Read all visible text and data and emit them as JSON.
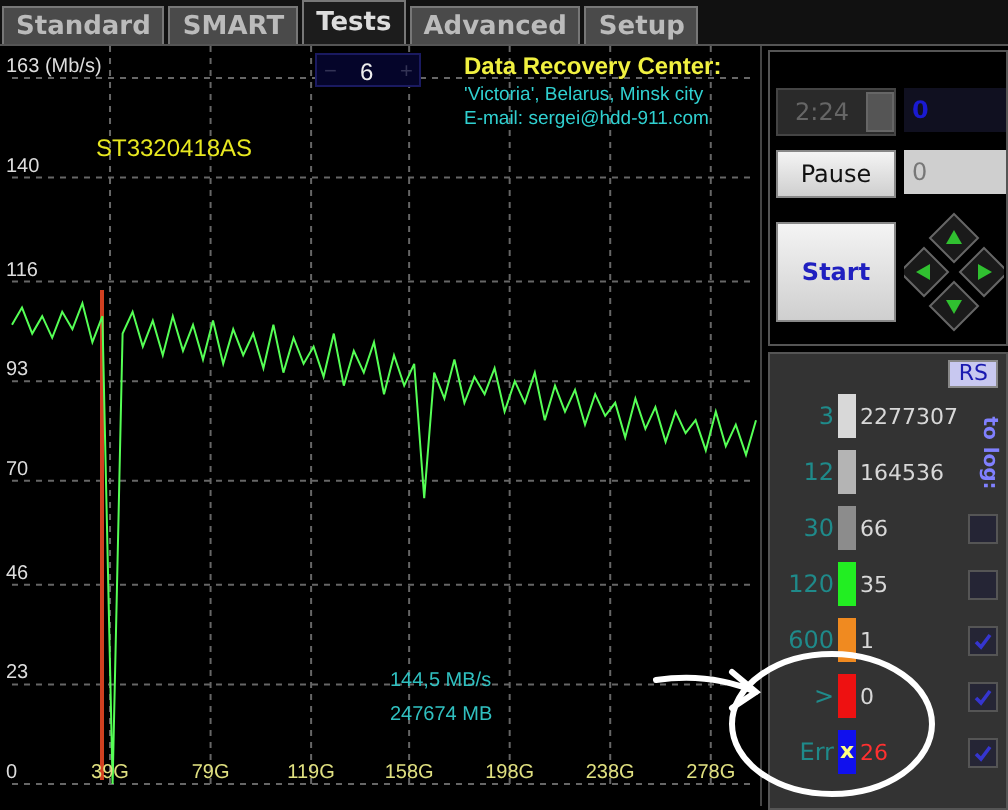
{
  "tabs": [
    {
      "label": "Standard",
      "selected": false
    },
    {
      "label": "SMART",
      "selected": false
    },
    {
      "label": "Tests",
      "selected": true
    },
    {
      "label": "Advanced",
      "selected": false
    },
    {
      "label": "Setup",
      "selected": false
    }
  ],
  "chart": {
    "drive_model": "ST3320418AS",
    "rate": "144,5 MB/s",
    "size": "247674 MB",
    "chart_data": {
      "type": "line",
      "xlim": [
        0,
        296
      ],
      "ylim": [
        0,
        163
      ],
      "grid": true,
      "yticks": [
        {
          "value": 163,
          "label": "163 (Mb/s)"
        },
        140,
        116,
        93,
        70,
        46,
        23,
        0
      ],
      "xticks": [
        {
          "value": 39,
          "label": "39G"
        },
        {
          "value": 79,
          "label": "79G"
        },
        {
          "value": 119,
          "label": "119G"
        },
        {
          "value": 158,
          "label": "158G"
        },
        {
          "value": 198,
          "label": "198G"
        },
        {
          "value": 238,
          "label": "238G"
        },
        {
          "value": 278,
          "label": "278G"
        }
      ],
      "x": [
        0,
        4,
        8,
        12,
        16,
        20,
        24,
        28,
        32,
        36,
        40,
        44,
        48,
        52,
        56,
        60,
        64,
        68,
        72,
        76,
        80,
        84,
        88,
        92,
        96,
        100,
        104,
        108,
        112,
        116,
        120,
        124,
        128,
        132,
        136,
        140,
        144,
        148,
        152,
        156,
        160,
        164,
        168,
        172,
        176,
        180,
        184,
        188,
        192,
        196,
        200,
        204,
        208,
        212,
        216,
        220,
        224,
        228,
        232,
        236,
        240,
        244,
        248,
        252,
        256,
        260,
        264,
        268,
        272,
        276,
        280,
        284,
        288,
        292,
        296
      ],
      "series": [
        {
          "color": "#55ff55",
          "values": [
            106,
            110,
            104,
            108,
            103,
            109,
            105,
            111,
            102,
            108,
            0,
            104,
            109,
            101,
            107,
            99,
            108,
            100,
            106,
            98,
            107,
            97,
            105,
            99,
            104,
            96,
            106,
            95,
            103,
            97,
            101,
            94,
            104,
            92,
            100,
            95,
            102,
            90,
            99,
            92,
            97,
            66,
            95,
            89,
            98,
            88,
            94,
            90,
            96,
            86,
            93,
            88,
            95,
            84,
            92,
            86,
            91,
            83,
            90,
            85,
            88,
            80,
            89,
            82,
            87,
            79,
            86,
            81,
            84,
            77,
            86,
            78,
            83,
            76,
            84
          ]
        }
      ]
    }
  },
  "spinner": {
    "minus": "−",
    "value": "6",
    "plus": "+"
  },
  "info": {
    "title": "Data Recovery Center:",
    "line_1": "'Victoria', Belarus, Minsk city",
    "line_2": "E-mail: sergei@hdd-911.com"
  },
  "controls": {
    "timer": "2:24",
    "field_1": "0",
    "field_2": "0",
    "pause": "Pause",
    "start": "Start"
  },
  "legend": {
    "reset": "RS",
    "to_log": "to log:",
    "rows": [
      {
        "threshold": "3",
        "color": "#d8d8d8",
        "count": "2277307",
        "kind": "plain"
      },
      {
        "threshold": "12",
        "color": "#b4b4b4",
        "count": "164536",
        "kind": "plain"
      },
      {
        "threshold": "30",
        "color": "#8c8c8c",
        "count": "66",
        "kind": "checkbox",
        "checked": false
      },
      {
        "threshold": "120",
        "color": "#22ee22",
        "count": "35",
        "kind": "checkbox",
        "checked": false
      },
      {
        "threshold": "600",
        "color": "#f08a20",
        "count": "1",
        "kind": "checkbox",
        "checked": true
      },
      {
        "threshold": ">",
        "color": "#ee1111",
        "count": "0",
        "kind": "checkbox",
        "checked": true
      },
      {
        "threshold": "Err",
        "color": "#1010ee",
        "marker": "x",
        "count": "26",
        "kind": "checkbox",
        "checked": true,
        "error": true
      }
    ]
  }
}
